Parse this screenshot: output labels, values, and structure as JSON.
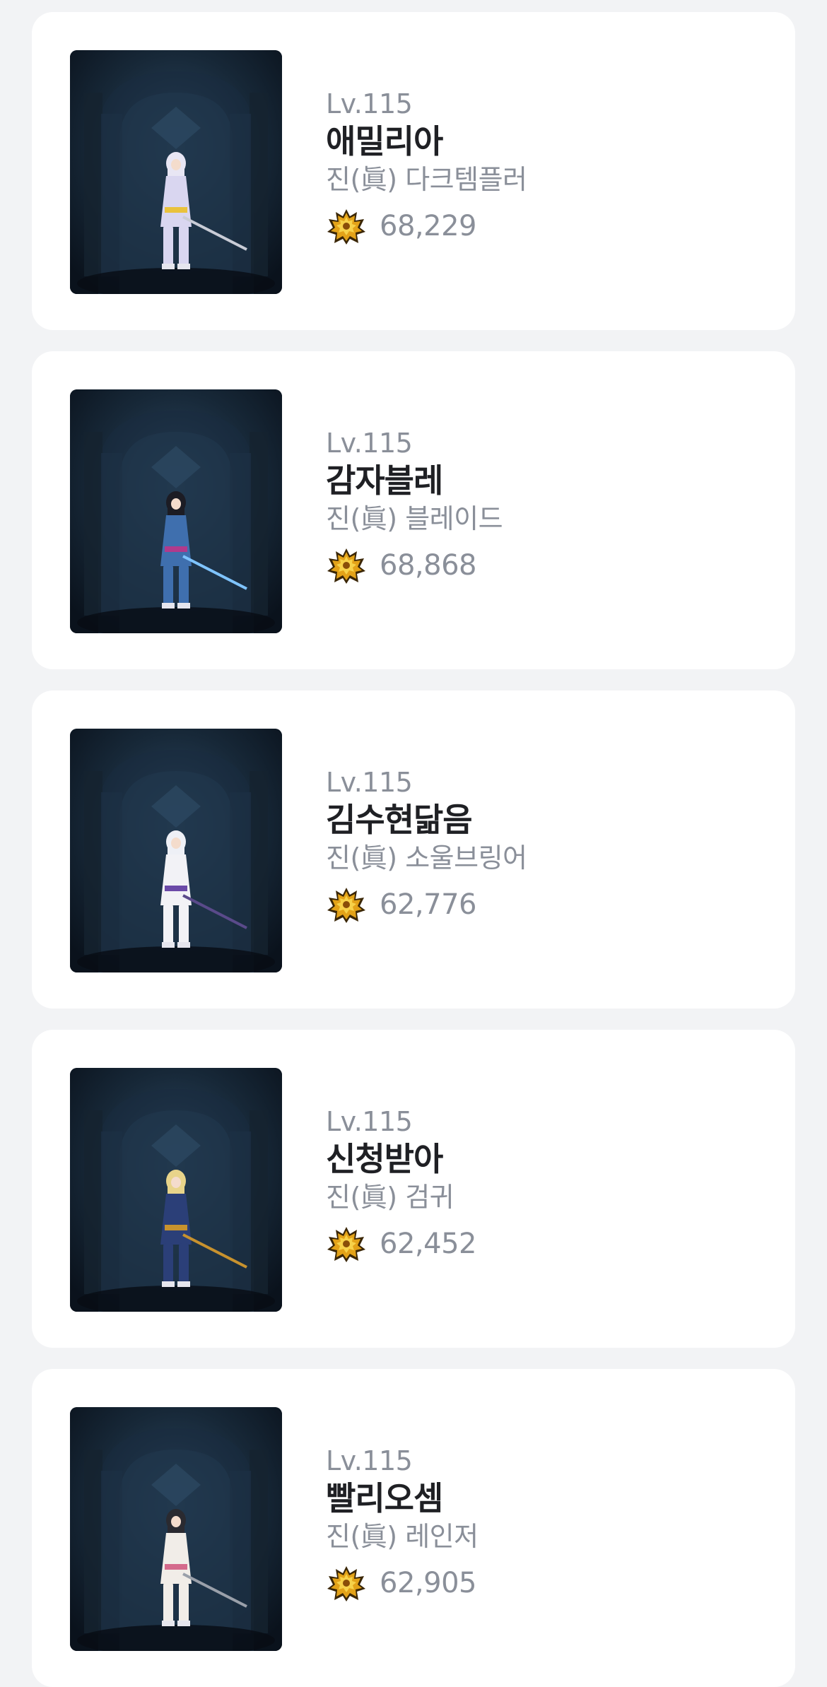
{
  "characters": [
    {
      "level": "Lv.115",
      "name": "애밀리아",
      "job": "진(眞) 다크템플러",
      "fame": "68,229",
      "fame_icon": "fame-crest-icon",
      "colors": {
        "hair": "#e8e6f4",
        "outfit": "#d9d6f0",
        "accent": "#e9c23c",
        "weapon": "#c9ccd6"
      }
    },
    {
      "level": "Lv.115",
      "name": "감자블레",
      "job": "진(眞) 블레이드",
      "fame": "68,868",
      "fame_icon": "fame-crest-icon",
      "colors": {
        "hair": "#1c1c24",
        "outfit": "#3f6fae",
        "accent": "#b03a8c",
        "weapon": "#7fc4ff"
      }
    },
    {
      "level": "Lv.115",
      "name": "김수현닮음",
      "job": "진(眞) 소울브링어",
      "fame": "62,776",
      "fame_icon": "fame-crest-icon",
      "colors": {
        "hair": "#eef0f6",
        "outfit": "#f2f2f6",
        "accent": "#6b4aa8",
        "weapon": "#5a4a8a"
      }
    },
    {
      "level": "Lv.115",
      "name": "신청받아",
      "job": "진(眞) 검귀",
      "fame": "62,452",
      "fame_icon": "fame-crest-icon",
      "colors": {
        "hair": "#e8d48a",
        "outfit": "#2b3f78",
        "accent": "#c8922e",
        "weapon": "#c8922e"
      }
    },
    {
      "level": "Lv.115",
      "name": "빨리오셈",
      "job": "진(眞) 레인저",
      "fame": "62,905",
      "fame_icon": "fame-crest-icon",
      "colors": {
        "hair": "#2a2a30",
        "outfit": "#f1ede8",
        "accent": "#d46a8c",
        "weapon": "#9aa0aa"
      }
    }
  ]
}
